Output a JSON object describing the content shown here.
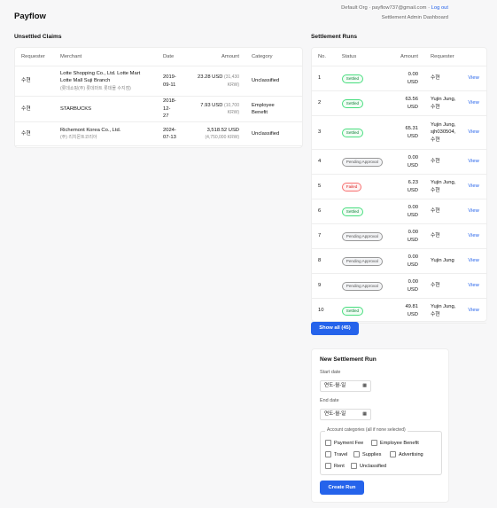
{
  "header": {
    "brand": "Payflow",
    "account_prefix": "Default Org · payflow737@gmail.com · ",
    "logout": "Log out",
    "dashboard_link": "Settlement Admin Dashboard"
  },
  "claims": {
    "title": "Unsettled Claims",
    "columns": [
      "Requester",
      "Merchant",
      "Date",
      "Amount",
      "Category"
    ],
    "rows": [
      {
        "requester": "수현",
        "merchant_line1": "Lotte Shopping Co., Ltd. Lotte Mart",
        "merchant_line2": "Lotte Mall Suji Branch",
        "merchant_sub": "(롯데쇼핑(주) 롯데마트 롯데몰 수지점)",
        "date_line1": "2019-",
        "date_line2": "09-11",
        "amount_main": "23.28 USD",
        "amount_sub1": "(31,430",
        "amount_sub2": "KRW)",
        "category_line1": "Unclassified",
        "category_line2": ""
      },
      {
        "requester": "수현",
        "merchant_line1": "STARBUCKS",
        "merchant_line2": "",
        "merchant_sub": "",
        "date_line1": "2018-12-",
        "date_line2": "27",
        "amount_main": "7.93 USD",
        "amount_sub1": "(10,700",
        "amount_sub2": "KRW)",
        "category_line1": "Employee",
        "category_line2": "Benefit"
      },
      {
        "requester": "수현",
        "merchant_line1": "Richemont Korea Co., Ltd.",
        "merchant_line2": "",
        "merchant_sub": "(주) 리치몬트코리아",
        "date_line1": "2024-",
        "date_line2": "07-13",
        "amount_main": "3,518.52 USD",
        "amount_sub1": "(4,750,000 KRW)",
        "amount_sub2": "",
        "category_line1": "Unclassified",
        "category_line2": ""
      }
    ]
  },
  "runs": {
    "title": "Settlement Runs",
    "columns": [
      "No.",
      "Status",
      "Amount",
      "Requester"
    ],
    "rows": [
      {
        "no": "1",
        "status": "Settled",
        "status_type": "settled",
        "amount1": "0.00",
        "amount2": "USD",
        "req": [
          "수현"
        ],
        "view": "View"
      },
      {
        "no": "2",
        "status": "Settled",
        "status_type": "settled",
        "amount1": "63.56",
        "amount2": "USD",
        "req": [
          "Yujin Jung,",
          "수현"
        ],
        "view": "View"
      },
      {
        "no": "3",
        "status": "Settled",
        "status_type": "settled",
        "amount1": "65.31",
        "amount2": "USD",
        "req": [
          "Yujin Jung,",
          "sjh030504,",
          "수현"
        ],
        "view": "View"
      },
      {
        "no": "4",
        "status": "Pending Approval",
        "status_type": "pending",
        "amount1": "0.00",
        "amount2": "USD",
        "req": [
          "수현"
        ],
        "view": "View"
      },
      {
        "no": "5",
        "status": "Failed",
        "status_type": "failed",
        "amount1": "6.23",
        "amount2": "USD",
        "req": [
          "Yujin Jung,",
          "수현"
        ],
        "view": "View"
      },
      {
        "no": "6",
        "status": "Settled",
        "status_type": "settled",
        "amount1": "0.00",
        "amount2": "USD",
        "req": [
          "수현"
        ],
        "view": "View"
      },
      {
        "no": "7",
        "status": "Pending Approval",
        "status_type": "pending",
        "amount1": "0.00",
        "amount2": "USD",
        "req": [
          "수현"
        ],
        "view": "View"
      },
      {
        "no": "8",
        "status": "Pending Approval",
        "status_type": "pending",
        "amount1": "0.00",
        "amount2": "USD",
        "req": [
          "Yujin Jung"
        ],
        "view": "View"
      },
      {
        "no": "9",
        "status": "Pending Approval",
        "status_type": "pending",
        "amount1": "0.00",
        "amount2": "USD",
        "req": [
          "수현"
        ],
        "view": "View"
      },
      {
        "no": "10",
        "status": "Settled",
        "status_type": "settled",
        "amount1": "49.81",
        "amount2": "USD",
        "req": [
          "Yujin Jung,",
          "수현"
        ],
        "view": "View"
      }
    ],
    "show_all": "Show all (45)"
  },
  "new_run": {
    "title": "New Settlement Run",
    "start_label": "Start date",
    "start_value": "연도-월-일",
    "end_label": "End date",
    "end_value": "연도-월-일",
    "categories_legend": "Account categories (all if none selected)",
    "categories": [
      "Payment Fee",
      "Employee Benefit",
      "Travel",
      "Supplies",
      "Advertising",
      "Rent",
      "Unclassified"
    ],
    "create_button": "Create Run"
  },
  "colors": {
    "accent": "#2563eb",
    "settled": "#15803d",
    "failed": "#dc2626"
  }
}
